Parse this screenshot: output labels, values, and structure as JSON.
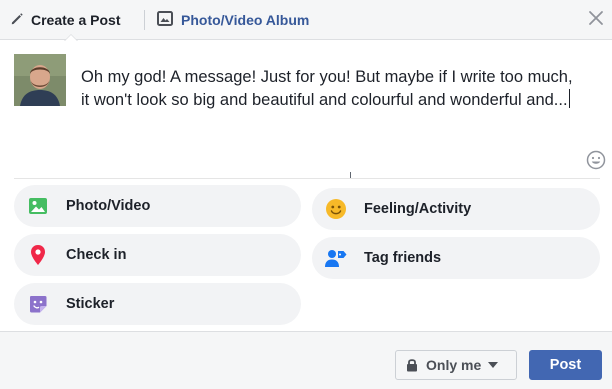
{
  "header": {
    "create_tab_label": "Create a Post",
    "album_tab_label": "Photo/Video Album"
  },
  "post": {
    "text": "Oh my god! A message! Just for you! But maybe if I write too much, it won't look so big and beautiful and colourful and wonderful and..."
  },
  "actions": {
    "photo_video": "Photo/Video",
    "check_in": "Check in",
    "sticker": "Sticker",
    "feeling_activity": "Feeling/Activity",
    "tag_friends": "Tag friends"
  },
  "footer": {
    "privacy_label": "Only me",
    "post_label": "Post"
  },
  "colors": {
    "brand_blue": "#4267b2",
    "link_blue": "#365899",
    "pill_bg": "#f2f3f5",
    "photo_icon_green": "#45bd62",
    "checkin_icon_red": "#f02849",
    "sticker_icon_purple": "#8c72cb",
    "feeling_icon_yellow": "#f7b928",
    "tag_icon_blue": "#1877f2"
  },
  "icons": {
    "create_tab": "pencil-icon",
    "album_tab": "photo-album-icon",
    "close": "close-icon",
    "emoji": "smiley-icon",
    "photo_video": "photo-icon",
    "check_in": "location-pin-icon",
    "sticker": "sticker-icon",
    "feeling_activity": "smiley-face-icon",
    "tag_friends": "tag-person-icon",
    "privacy": "lock-icon"
  }
}
